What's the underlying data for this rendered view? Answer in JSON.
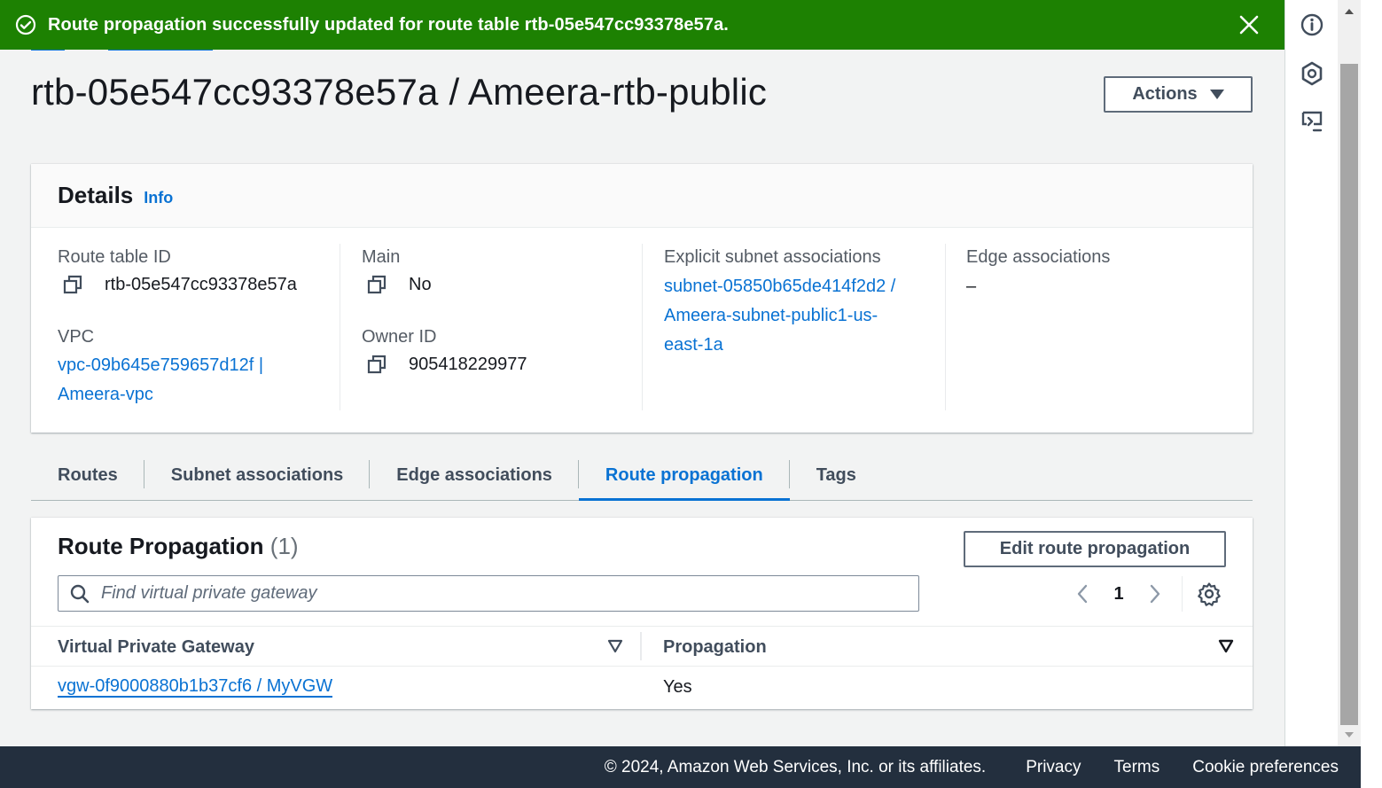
{
  "flash": {
    "message": "Route propagation successfully updated for route table rtb-05e547cc93378e57a."
  },
  "page": {
    "title": "rtb-05e547cc93378e57a / Ameera-rtb-public",
    "actions_label": "Actions"
  },
  "details": {
    "heading": "Details",
    "info_link": "Info",
    "route_table_id_label": "Route table ID",
    "route_table_id": "rtb-05e547cc93378e57a",
    "vpc_label": "VPC",
    "vpc_line1": "vpc-09b645e759657d12f |",
    "vpc_line2": "Ameera-vpc",
    "main_label": "Main",
    "main_value": "No",
    "owner_label": "Owner ID",
    "owner_value": "905418229977",
    "subnet_label": "Explicit subnet associations",
    "subnet_line1": "subnet-05850b65de414f2d2 /",
    "subnet_line2": "Ameera-subnet-public1-us-",
    "subnet_line3": "east-1a",
    "edge_label": "Edge associations",
    "edge_value": "–"
  },
  "tabs": [
    {
      "label": "Routes"
    },
    {
      "label": "Subnet associations"
    },
    {
      "label": "Edge associations"
    },
    {
      "label": "Route propagation",
      "active": true
    },
    {
      "label": "Tags"
    }
  ],
  "route_propagation": {
    "title": "Route Propagation",
    "count": "(1)",
    "edit_button": "Edit route propagation",
    "search_placeholder": "Find virtual private gateway",
    "page_number": "1",
    "columns": [
      "Virtual Private Gateway",
      "Propagation"
    ],
    "rows": [
      {
        "gateway": "vgw-0f9000880b1b37cf6 / MyVGW",
        "propagation": "Yes"
      }
    ]
  },
  "footer": {
    "copyright": "© 2024, Amazon Web Services, Inc. or its affiliates.",
    "privacy": "Privacy",
    "terms": "Terms",
    "cookies": "Cookie preferences"
  },
  "colors": {
    "success_green": "#1d8102",
    "link_blue": "#0972d3",
    "footer_bg": "#232f3e"
  }
}
